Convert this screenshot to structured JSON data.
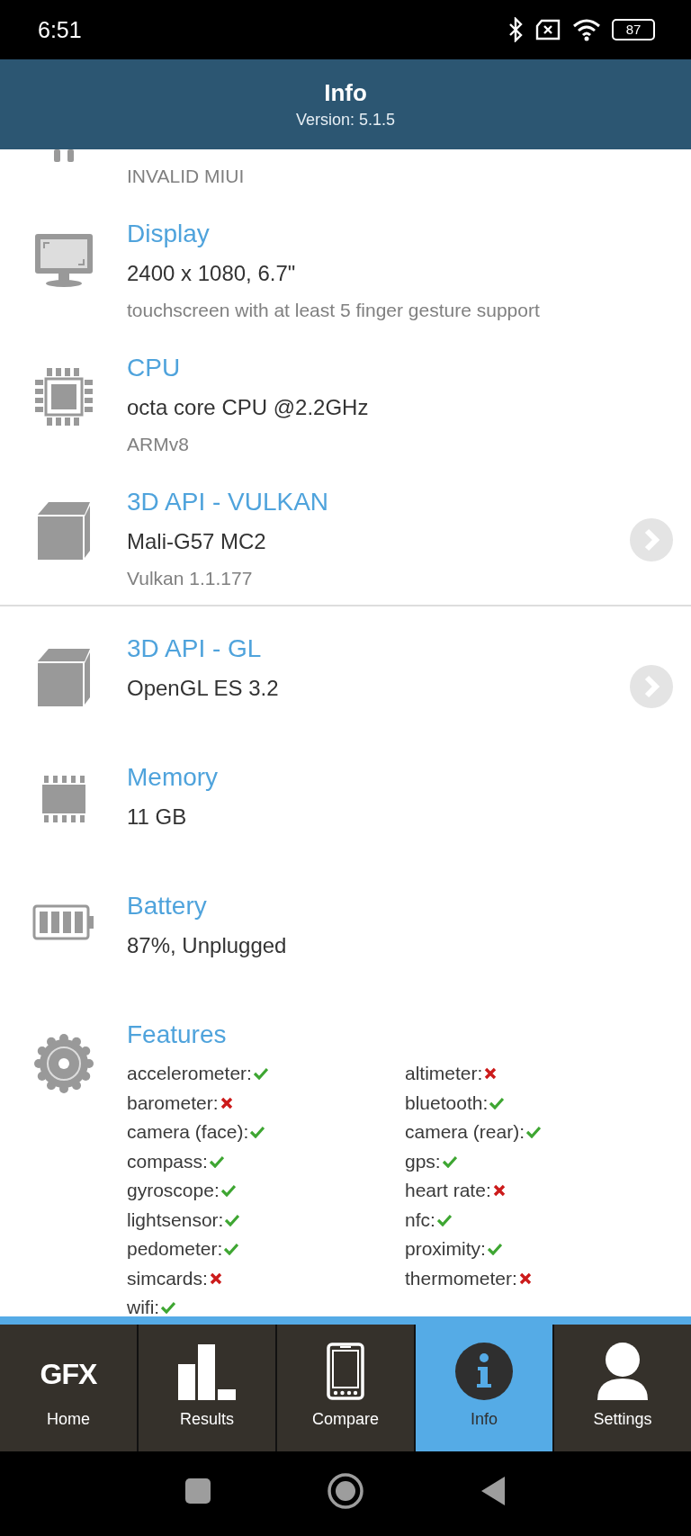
{
  "status_bar": {
    "time": "6:51",
    "battery": "87"
  },
  "header": {
    "title": "Info",
    "subtitle": "Version: 5.1.5"
  },
  "sections": [
    {
      "kind": "os",
      "subtitle": "INVALID MIUI"
    },
    {
      "kind": "display",
      "title": "Display",
      "value": "2400 x 1080, 6.7\"",
      "subtitle": "touchscreen with at least 5 finger gesture support"
    },
    {
      "kind": "cpu",
      "title": "CPU",
      "value": "octa core CPU @2.2GHz",
      "subtitle": "ARMv8"
    },
    {
      "kind": "gpu",
      "title": "3D API - VULKAN",
      "value": "Mali-G57 MC2",
      "subtitle": "Vulkan 1.1.177",
      "link": true
    },
    {
      "kind": "gpu",
      "title": "3D API - GL",
      "value": "OpenGL ES 3.2",
      "link": true
    },
    {
      "kind": "memory",
      "title": "Memory",
      "value": "11 GB"
    },
    {
      "kind": "battery",
      "title": "Battery",
      "value": "87%, Unplugged"
    },
    {
      "kind": "features",
      "title": "Features",
      "features": [
        {
          "name": "accelerometer:",
          "supported": true
        },
        {
          "name": "altimeter:",
          "supported": false
        },
        {
          "name": "barometer:",
          "supported": false
        },
        {
          "name": "bluetooth:",
          "supported": true
        },
        {
          "name": "camera (face):",
          "supported": true
        },
        {
          "name": "camera (rear):",
          "supported": true
        },
        {
          "name": "compass:",
          "supported": true
        },
        {
          "name": "gps:",
          "supported": true
        },
        {
          "name": "gyroscope:",
          "supported": true
        },
        {
          "name": "heart rate:",
          "supported": false
        },
        {
          "name": "lightsensor:",
          "supported": true
        },
        {
          "name": "nfc:",
          "supported": true
        },
        {
          "name": "pedometer:",
          "supported": true
        },
        {
          "name": "proximity:",
          "supported": true
        },
        {
          "name": "simcards:",
          "supported": false
        },
        {
          "name": "thermometer:",
          "supported": false
        },
        {
          "name": "wifi:",
          "supported": true
        }
      ]
    }
  ],
  "tabs": [
    {
      "kind": "home",
      "logo": "GFX",
      "label": "Home",
      "selected": false
    },
    {
      "kind": "results",
      "label": "Results",
      "selected": false
    },
    {
      "kind": "compare",
      "label": "Compare",
      "selected": false
    },
    {
      "kind": "info",
      "label": "Info",
      "selected": true
    },
    {
      "kind": "settings",
      "label": "Settings",
      "selected": false
    }
  ]
}
